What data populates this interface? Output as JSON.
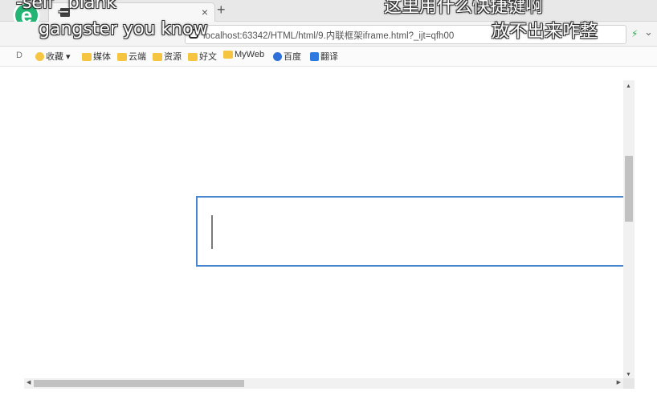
{
  "browser": {
    "tab": {
      "title": "",
      "close_glyph": "×"
    },
    "new_tab_glyph": "+",
    "address": {
      "url": "localhost:63342/HTML/html/9.内联框架iframe.html?_ijt=qfh00",
      "right_icon": "⚡",
      "menu_glyph": "⌄"
    },
    "bookmarks_toggle": "D",
    "bookmarks": [
      {
        "label": "收藏",
        "icon": "star-icon"
      },
      {
        "label": "媒体",
        "icon": "folder-icon"
      },
      {
        "label": "云端",
        "icon": "folder-icon"
      },
      {
        "label": "资源",
        "icon": "folder-icon"
      },
      {
        "label": "好文",
        "icon": "folder-icon"
      },
      {
        "label": "MyWeb",
        "icon": "folder-icon"
      },
      {
        "label": "百度",
        "icon": "paw-icon"
      },
      {
        "label": "翻译",
        "icon": "translate-icon"
      }
    ]
  },
  "scrollbars": {
    "up": "▲",
    "down": "▼",
    "left": "◀",
    "right": "▶"
  },
  "captions": {
    "line1": "-self _blank",
    "line2": "gangster you know",
    "line3": "这里用什么快捷键啊",
    "line4": "放不出来咋整"
  },
  "colors": {
    "iframe_border": "#4a86d0",
    "brand": "#22b573"
  }
}
